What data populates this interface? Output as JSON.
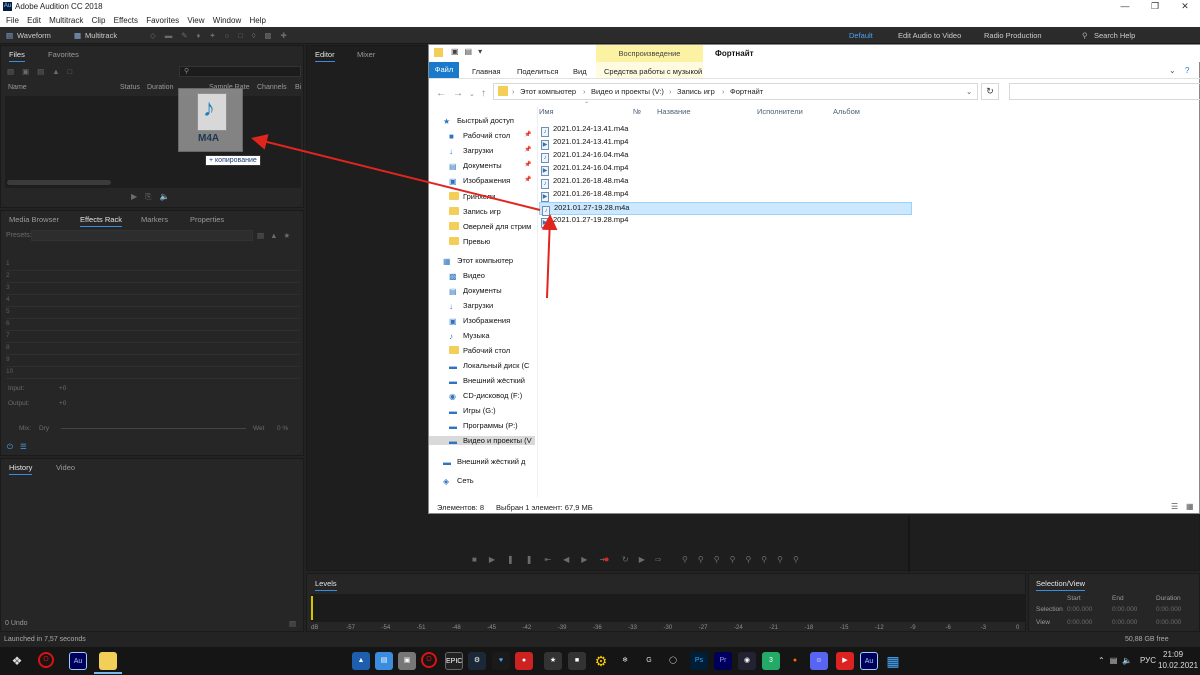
{
  "window": {
    "title": "Adobe Audition CC 2018",
    "app_icon": "Au"
  },
  "menu": [
    "File",
    "Edit",
    "Multitrack",
    "Clip",
    "Effects",
    "Favorites",
    "View",
    "Window",
    "Help"
  ],
  "toolbar": {
    "waveform": "Waveform",
    "multitrack": "Multitrack",
    "workspaces": [
      "Default",
      "Edit Audio to Video",
      "Radio Production"
    ],
    "search_help": "Search Help"
  },
  "files_panel": {
    "tabs": [
      "Files",
      "Favorites"
    ],
    "columns": [
      "Name",
      "Status",
      "Duration",
      "Sample Rate",
      "Channels",
      "Bi"
    ],
    "drag_file_label": "M4A",
    "drag_tooltip": "+ копирование"
  },
  "effects_panel": {
    "tabs": [
      "Media Browser",
      "Effects Rack",
      "Markers",
      "Properties"
    ],
    "presets_label": "Presets:",
    "rows": [
      "1",
      "2",
      "3",
      "4",
      "5",
      "6",
      "7",
      "8",
      "9",
      "10"
    ],
    "input_label": "Input:",
    "input_value": "+0",
    "output_label": "Output:",
    "output_value": "+0",
    "mix_label": "Mix:",
    "dry_label": "Dry",
    "wet_label": "Wet",
    "wet_value": "0 %"
  },
  "history_panel": {
    "tabs": [
      "History",
      "Video"
    ],
    "undo_count": "0 Undo",
    "launched": "Launched in 7,57 seconds"
  },
  "editor_panel": {
    "tabs": [
      "Editor",
      "Mixer"
    ]
  },
  "levels_panel": {
    "title": "Levels",
    "ticks": [
      "dB",
      "-57",
      "-54",
      "-51",
      "-48",
      "-45",
      "-42",
      "-39",
      "-36",
      "-33",
      "-30",
      "-27",
      "-24",
      "-21",
      "-18",
      "-15",
      "-12",
      "-9",
      "-6",
      "-3",
      "0"
    ]
  },
  "selection_panel": {
    "title": "Selection/View",
    "headers": [
      "Start",
      "End",
      "Duration"
    ],
    "rows": [
      {
        "label": "Selection",
        "start": "0:00.000",
        "end": "0:00.000",
        "duration": "0:00.000"
      },
      {
        "label": "View",
        "start": "0:00.000",
        "end": "0:00.000",
        "duration": "0:00.000"
      }
    ],
    "disk_free": "50,88 GB free"
  },
  "explorer": {
    "ribbon_context": "Воспроизведение",
    "window_title": "Фортнайт",
    "tabs": [
      "Файл",
      "Главная",
      "Поделиться",
      "Вид"
    ],
    "context_tab": "Средства работы с музыкой",
    "address": [
      "Этот компьютер",
      "Видео и проекты (V:)",
      "Запись игр",
      "Фортнайт"
    ],
    "tree": [
      {
        "label": "Быстрый доступ",
        "kind": "star",
        "indent": 0,
        "pinned": false
      },
      {
        "label": "Рабочий стол",
        "kind": "desktop",
        "indent": 1,
        "pinned": true
      },
      {
        "label": "Загрузки",
        "kind": "download",
        "indent": 1,
        "pinned": true
      },
      {
        "label": "Документы",
        "kind": "docs",
        "indent": 1,
        "pinned": true
      },
      {
        "label": "Изображения",
        "kind": "images",
        "indent": 1,
        "pinned": true
      },
      {
        "label": "Гринхели",
        "kind": "folder",
        "indent": 1,
        "pinned": false
      },
      {
        "label": "Запись игр",
        "kind": "folder",
        "indent": 1,
        "pinned": false
      },
      {
        "label": "Оверлей для стрим",
        "kind": "folder",
        "indent": 1,
        "pinned": false
      },
      {
        "label": "Превью",
        "kind": "folder",
        "indent": 1,
        "pinned": false
      },
      {
        "label": "Этот компьютер",
        "kind": "pc",
        "indent": 0,
        "pinned": false
      },
      {
        "label": "Видео",
        "kind": "video",
        "indent": 1,
        "pinned": false
      },
      {
        "label": "Документы",
        "kind": "docs",
        "indent": 1,
        "pinned": false
      },
      {
        "label": "Загрузки",
        "kind": "download",
        "indent": 1,
        "pinned": false
      },
      {
        "label": "Изображения",
        "kind": "images",
        "indent": 1,
        "pinned": false
      },
      {
        "label": "Музыка",
        "kind": "music",
        "indent": 1,
        "pinned": false
      },
      {
        "label": "Рабочий стол",
        "kind": "folder",
        "indent": 1,
        "pinned": false
      },
      {
        "label": "Локальный диск (C",
        "kind": "drive",
        "indent": 1,
        "pinned": false
      },
      {
        "label": "Внешний жёсткий",
        "kind": "drive",
        "indent": 1,
        "pinned": false
      },
      {
        "label": "CD-дисковод (F:)",
        "kind": "cd",
        "indent": 1,
        "pinned": false
      },
      {
        "label": "Игры (G:)",
        "kind": "drive",
        "indent": 1,
        "pinned": false
      },
      {
        "label": "Программы (P:)",
        "kind": "drive",
        "indent": 1,
        "pinned": false
      },
      {
        "label": "Видео и проекты (V",
        "kind": "drive",
        "indent": 1,
        "pinned": false
      },
      {
        "label": "Внешний жёсткий д",
        "kind": "drive",
        "indent": 0,
        "pinned": false
      },
      {
        "label": "Сеть",
        "kind": "network",
        "indent": 0,
        "pinned": false
      }
    ],
    "columns": [
      "Имя",
      "№",
      "Название",
      "Исполнители",
      "Альбом"
    ],
    "files": [
      {
        "name": "2021.01.24-13.41.m4a",
        "type": "m4a",
        "selected": false
      },
      {
        "name": "2021.01.24-13.41.mp4",
        "type": "mp4",
        "selected": false
      },
      {
        "name": "2021.01.24-16.04.m4a",
        "type": "m4a",
        "selected": false
      },
      {
        "name": "2021.01.24-16.04.mp4",
        "type": "mp4",
        "selected": false
      },
      {
        "name": "2021.01.26-18.48.m4a",
        "type": "m4a",
        "selected": false
      },
      {
        "name": "2021.01.26-18.48.mp4",
        "type": "mp4",
        "selected": false
      },
      {
        "name": "2021.01.27-19.28.m4a",
        "type": "m4a",
        "selected": true
      },
      {
        "name": "2021.01.27-19.28.mp4",
        "type": "mp4",
        "selected": false
      }
    ],
    "status_count": "Элементов: 8",
    "status_selected": "Выбран 1 элемент: 67,9 МБ"
  },
  "taskbar": {
    "language": "РУС",
    "time": "21:09",
    "date": "10.02.2021"
  },
  "colors": {
    "accent": "#3a8dde",
    "explorer_blue": "#1979ca",
    "selection": "#cce8ff",
    "drag_arrow": "#e0261c"
  }
}
